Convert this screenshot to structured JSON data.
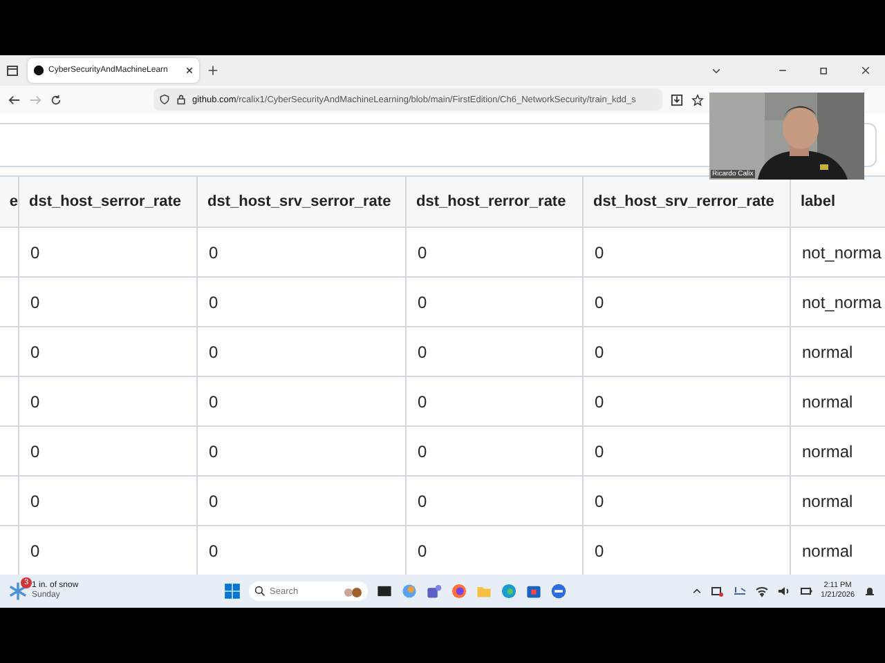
{
  "browser": {
    "tabs": [
      {
        "title": "CyberSecurityAndMachineLearn",
        "selected": true
      }
    ],
    "url_host": "github.com",
    "url_path": "/rcalix1/CyberSecurityAndMachineLearning/blob/main/FirstEdition/Ch6_NetworkSecurity/train_kdd_s"
  },
  "webcam": {
    "kind": "picture",
    "name": "Ricardo Calix"
  },
  "table": {
    "columns": [
      "e",
      "dst_host_serror_rate",
      "dst_host_srv_serror_rate",
      "dst_host_rerror_rate",
      "dst_host_srv_rerror_rate",
      "label"
    ],
    "rows": [
      [
        "",
        "0",
        "0",
        "0",
        "0",
        "not_norma"
      ],
      [
        "",
        "0",
        "0",
        "0",
        "0",
        "not_norma"
      ],
      [
        "",
        "0",
        "0",
        "0",
        "0",
        "normal"
      ],
      [
        "",
        "0",
        "0",
        "0",
        "0",
        "normal"
      ],
      [
        "",
        "0",
        "0",
        "0",
        "0",
        "normal"
      ],
      [
        "",
        "0",
        "0",
        "0",
        "0",
        "normal"
      ],
      [
        "",
        "0",
        "0",
        "0",
        "0",
        "normal"
      ]
    ]
  },
  "taskbar": {
    "weather": {
      "badge": "3",
      "title": "1 in. of snow",
      "subtitle": "Sunday"
    },
    "search": {
      "placeholder": "Search"
    },
    "time": "2:11 PM",
    "date": "1/21/2026"
  }
}
